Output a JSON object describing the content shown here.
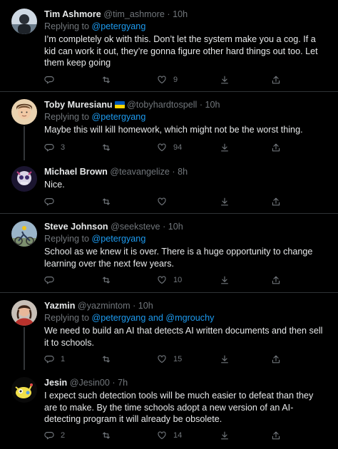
{
  "tweets": [
    {
      "name": "Tim Ashmore",
      "handle": "@tim_ashmore",
      "time": "10h",
      "replying_prefix": "Replying to",
      "replying_to": "@petergyang",
      "text": "I’m completely ok with this. Don’t let the system make you a cog. If a kid can work it out, they’re gonna figure other hard things out too. Let them keep going",
      "replies": "",
      "retweets": "",
      "likes": "9"
    },
    {
      "name": "Toby Muresianu",
      "handle": "@tobyhardtospell",
      "time": "10h",
      "replying_prefix": "Replying to",
      "replying_to": "@petergyang",
      "text": "Maybe this will kill homework, which might not be the worst thing.",
      "replies": "3",
      "retweets": "",
      "likes": "94"
    },
    {
      "name": "Michael Brown",
      "handle": "@teavangelize",
      "time": "8h",
      "text": "Nice.",
      "replies": "",
      "retweets": "",
      "likes": ""
    },
    {
      "name": "Steve Johnson",
      "handle": "@seeksteve",
      "time": "10h",
      "replying_prefix": "Replying to",
      "replying_to": "@petergyang",
      "text": "School as we knew it is over. There is a huge opportunity to change learning over the next few years.",
      "replies": "",
      "retweets": "",
      "likes": "10"
    },
    {
      "name": "Yazmin",
      "handle": "@yazmintom",
      "time": "10h",
      "replying_prefix": "Replying to",
      "replying_to": "@petergyang and @mgrouchy",
      "text": "We need to build an AI that detects AI written documents and then sell it to schools.",
      "replies": "1",
      "retweets": "",
      "likes": "15"
    },
    {
      "name": "Jesin",
      "handle": "@Jesin00",
      "time": "7h",
      "text": "I expect such detection tools will be much easier to defeat than they are to make. By the time schools adopt a new version of an AI-detecting program it will already be obsolete.",
      "replies": "2",
      "retweets": "",
      "likes": "14"
    }
  ],
  "sep": " · ",
  "colors": {
    "background": "#000000",
    "text": "#e7e9ea",
    "muted": "#71767b",
    "link": "#1d9bf0",
    "divider": "#2f3336"
  },
  "icons": [
    "reply-icon",
    "retweet-icon",
    "like-icon",
    "download-icon",
    "share-icon"
  ]
}
